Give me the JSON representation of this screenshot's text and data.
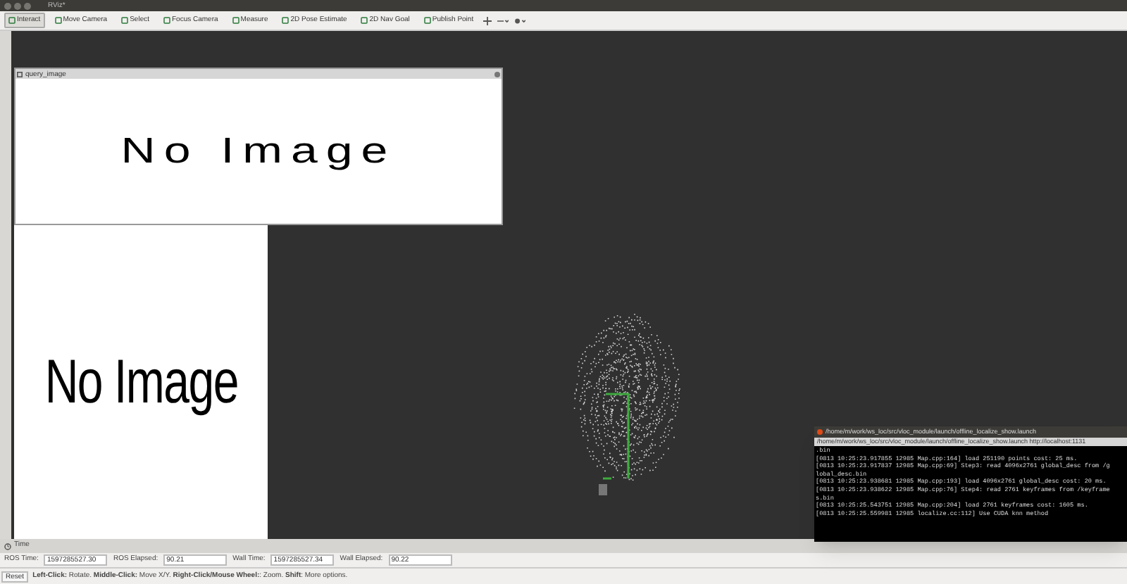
{
  "window": {
    "title": "RViz*"
  },
  "toolbar": [
    {
      "label": "Interact",
      "selected": true
    },
    {
      "label": "Move Camera",
      "selected": false
    },
    {
      "label": "Select",
      "selected": false
    },
    {
      "label": "Focus Camera",
      "selected": false
    },
    {
      "label": "Measure",
      "selected": false
    },
    {
      "label": "2D Pose Estimate",
      "selected": false
    },
    {
      "label": "2D Nav Goal",
      "selected": false
    },
    {
      "label": "Publish Point",
      "selected": false
    }
  ],
  "image_panels": [
    {
      "title": "query_image",
      "message": "No Image"
    },
    {
      "message": "No Image"
    }
  ],
  "terminal": {
    "title": "/home/m/work/ws_loc/src/vloc_module/launch/offline_localize_show.launch",
    "tab": "/home/m/work/ws_loc/src/vloc_module/launch/offline_localize_show.launch http://localhost:1131",
    "lines": [
      ".bin",
      "[0813 10:25:23.917855 12985 Map.cpp:164] load 251190 points cost: 25 ms.",
      "[0813 10:25:23.917837 12985 Map.cpp:69] Step3: read 4096x2761 global_desc from /g",
      "lobal_desc.bin",
      "[0813 10:25:23.938681 12985 Map.cpp:193] load 4096x2761 global_desc cost: 20 ms.",
      "[0813 10:25:23.938622 12985 Map.cpp:76] Step4: read 2761 keyframes from /keyframe",
      "s.bin",
      "[0813 10:25:25.543751 12985 Map.cpp:204] load 2761 keyframes cost: 1605 ms.",
      "[0813 10:25:25.559981 12985 localize.cc:112] Use CUDA knn method"
    ]
  },
  "time_panel": {
    "title": "Time",
    "fields": [
      {
        "label": "ROS Time:",
        "value": "1597285527.30"
      },
      {
        "label": "ROS Elapsed:",
        "value": "90.21"
      },
      {
        "label": "Wall Time:",
        "value": "1597285527.34"
      },
      {
        "label": "Wall Elapsed:",
        "value": "90.22"
      }
    ]
  },
  "status_bar": {
    "button": "Reset",
    "hint": "**Left-Click:** Rotate. **Middle-Click:** Move X/Y. **Right-Click/Mouse Wheel:**: Zoom. **Shift**: More options."
  }
}
